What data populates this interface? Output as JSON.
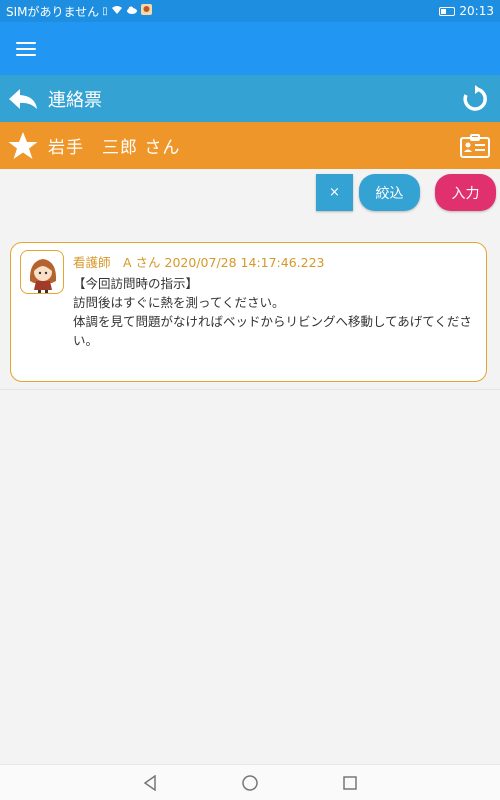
{
  "status_bar": {
    "carrier": "SIMがありません",
    "time": "20:13",
    "icons": [
      "sim-icon",
      "wifi-icon",
      "cloud-icon",
      "app-icon",
      "battery-icon"
    ]
  },
  "app_bar": {
    "menu_icon": "hamburger-menu-icon"
  },
  "title_bar": {
    "title": "連絡票",
    "back_icon": "back-arrow-icon",
    "refresh_icon": "refresh-icon"
  },
  "patient_bar": {
    "name": "岩手　三郎 さん",
    "star_icon": "star-icon",
    "card_icon": "id-card-icon"
  },
  "actions": {
    "clear_label": "×",
    "filter_label": "絞込",
    "input_label": "入力"
  },
  "messages": [
    {
      "author": "看護師　A さん",
      "timestamp": "2020/07/28 14:17:46.223",
      "text": "【今回訪問時の指示】\n訪問後はすぐに熱を測ってください。\n体調を見て問題がなければベッドからリビングへ移動してあげてください。"
    }
  ],
  "colors": {
    "status_bar": "#1e8fe0",
    "app_bar": "#2196f3",
    "title_bar": "#35a2d4",
    "patient_bar": "#ef962a",
    "input_button": "#e0306e",
    "card_border": "#e2a631"
  }
}
